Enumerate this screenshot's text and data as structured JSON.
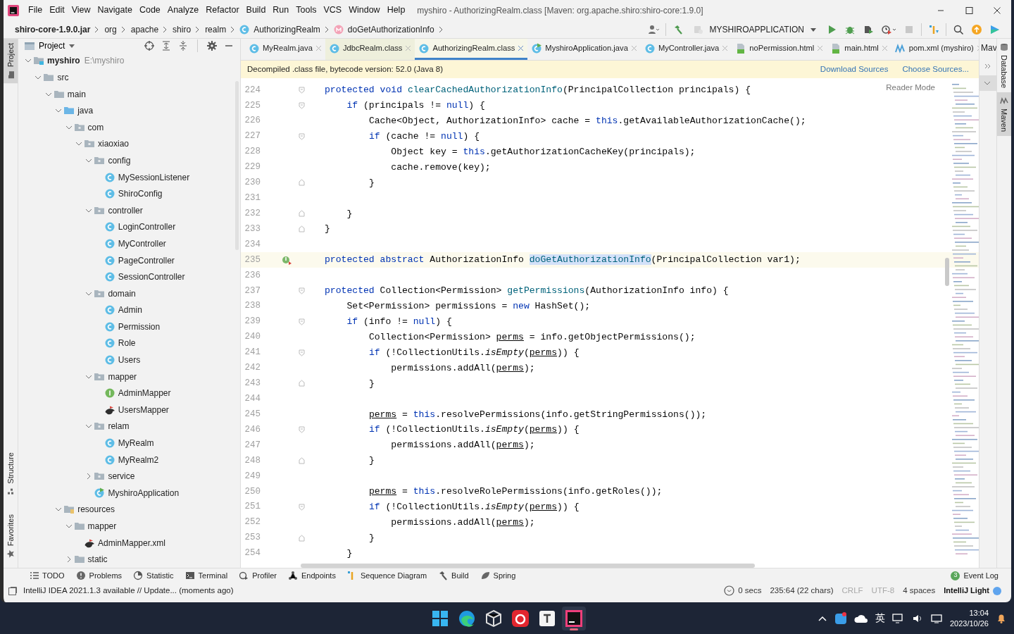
{
  "window": {
    "title": "myshiro - AuthorizingRealm.class [Maven: org.apache.shiro:shiro-core:1.9.0]"
  },
  "menu": [
    "File",
    "Edit",
    "View",
    "Navigate",
    "Code",
    "Analyze",
    "Refactor",
    "Build",
    "Run",
    "Tools",
    "VCS",
    "Window",
    "Help"
  ],
  "breadcrumb": [
    {
      "text": "shiro-core-1.9.0.jar",
      "kind": "jar"
    },
    {
      "text": "org",
      "kind": "package"
    },
    {
      "text": "apache",
      "kind": "package"
    },
    {
      "text": "shiro",
      "kind": "package"
    },
    {
      "text": "realm",
      "kind": "package"
    },
    {
      "text": "AuthorizingRealm",
      "kind": "class"
    },
    {
      "text": "doGetAuthorizationInfo",
      "kind": "method"
    }
  ],
  "run_config": "MYSHIROAPPLICATION",
  "left_stripe": [
    {
      "label": "Project",
      "kind": "project",
      "selected": true
    },
    {
      "label": "Structure",
      "kind": "structure",
      "selected": false
    },
    {
      "label": "Favorites",
      "kind": "favorites",
      "selected": false
    }
  ],
  "project": {
    "title": "Project",
    "tree": [
      {
        "label": "myshiro",
        "hint": "E:\\myshiro",
        "kind": "module",
        "expanded": true,
        "children": [
          {
            "label": "src",
            "kind": "folder",
            "expanded": true,
            "children": [
              {
                "label": "main",
                "kind": "folder",
                "expanded": true,
                "children": [
                  {
                    "label": "java",
                    "kind": "source",
                    "expanded": true,
                    "children": [
                      {
                        "label": "com",
                        "kind": "package",
                        "expanded": true,
                        "children": [
                          {
                            "label": "xiaoxiao",
                            "kind": "package",
                            "expanded": true,
                            "children": [
                              {
                                "label": "config",
                                "kind": "package",
                                "expanded": true,
                                "children": [
                                  {
                                    "label": "MySessionListener",
                                    "kind": "class"
                                  },
                                  {
                                    "label": "ShiroConfig",
                                    "kind": "class"
                                  }
                                ]
                              },
                              {
                                "label": "controller",
                                "kind": "package",
                                "expanded": true,
                                "children": [
                                  {
                                    "label": "LoginController",
                                    "kind": "class"
                                  },
                                  {
                                    "label": "MyController",
                                    "kind": "class"
                                  },
                                  {
                                    "label": "PageController",
                                    "kind": "class"
                                  },
                                  {
                                    "label": "SessionController",
                                    "kind": "class"
                                  }
                                ]
                              },
                              {
                                "label": "domain",
                                "kind": "package",
                                "expanded": true,
                                "children": [
                                  {
                                    "label": "Admin",
                                    "kind": "class"
                                  },
                                  {
                                    "label": "Permission",
                                    "kind": "class"
                                  },
                                  {
                                    "label": "Role",
                                    "kind": "class"
                                  },
                                  {
                                    "label": "Users",
                                    "kind": "class"
                                  }
                                ]
                              },
                              {
                                "label": "mapper",
                                "kind": "package",
                                "expanded": true,
                                "children": [
                                  {
                                    "label": "AdminMapper",
                                    "kind": "interface"
                                  },
                                  {
                                    "label": "UsersMapper",
                                    "kind": "mapper"
                                  }
                                ]
                              },
                              {
                                "label": "relam",
                                "kind": "package",
                                "expanded": true,
                                "children": [
                                  {
                                    "label": "MyRealm",
                                    "kind": "class"
                                  },
                                  {
                                    "label": "MyRealm2",
                                    "kind": "class"
                                  }
                                ]
                              },
                              {
                                "label": "service",
                                "kind": "package",
                                "expanded": false
                              },
                              {
                                "label": "MyshiroApplication",
                                "kind": "app"
                              }
                            ]
                          }
                        ]
                      }
                    ]
                  },
                  {
                    "label": "resources",
                    "kind": "resources",
                    "expanded": true,
                    "children": [
                      {
                        "label": "mapper",
                        "kind": "folder",
                        "expanded": true,
                        "children": [
                          {
                            "label": "AdminMapper.xml",
                            "kind": "mapper"
                          }
                        ]
                      },
                      {
                        "label": "static",
                        "kind": "folder",
                        "expanded": false
                      }
                    ]
                  }
                ]
              }
            ]
          }
        ]
      }
    ]
  },
  "tabs": [
    {
      "label": "MyRealm.java",
      "kind": "class",
      "selected": false
    },
    {
      "label": "JdbcRealm.class",
      "kind": "class",
      "selected": false,
      "color": "#eeefdc"
    },
    {
      "label": "AuthorizingRealm.class",
      "kind": "class",
      "selected": true,
      "color": "#f6f6e9"
    },
    {
      "label": "MyshiroApplication.java",
      "kind": "app",
      "selected": false
    },
    {
      "label": "MyController.java",
      "kind": "class",
      "selected": false
    },
    {
      "label": "noPermission.html",
      "kind": "html",
      "selected": false
    },
    {
      "label": "main.html",
      "kind": "html",
      "selected": false
    },
    {
      "label": "pom.xml (myshiro)",
      "kind": "maven",
      "selected": false
    }
  ],
  "notice": {
    "text": "Decompiled .class file, bytecode version: 52.0 (Java 8)",
    "links": [
      "Download Sources",
      "Choose Sources..."
    ]
  },
  "reader_mode": "Reader Mode",
  "code_lines": [
    {
      "number": "224",
      "fold_open": true,
      "fold_close": false,
      "current": false,
      "tokens": [
        {
          "kind": "kw",
          "text": "protected void "
        },
        {
          "kind": "decl",
          "text": "clearCachedAuthorizationInfo"
        },
        {
          "kind": "plain",
          "text": "(PrincipalCollection principals) {"
        }
      ]
    },
    {
      "number": "225",
      "fold_open": true,
      "fold_close": false,
      "current": false,
      "tokens": [
        {
          "kind": "kw",
          "text": "    if"
        },
        {
          "kind": "plain",
          "text": " (principals != "
        },
        {
          "kind": "kw",
          "text": "null"
        },
        {
          "kind": "plain",
          "text": ") {"
        }
      ]
    },
    {
      "number": "226",
      "fold_open": false,
      "fold_close": false,
      "current": false,
      "tokens": [
        {
          "kind": "plain",
          "text": "        Cache<Object, AuthorizationInfo> cache = "
        },
        {
          "kind": "kw",
          "text": "this"
        },
        {
          "kind": "plain",
          "text": ".getAvailableAuthorizationCache();"
        }
      ]
    },
    {
      "number": "227",
      "fold_open": true,
      "fold_close": false,
      "current": false,
      "tokens": [
        {
          "kind": "kw",
          "text": "        if"
        },
        {
          "kind": "plain",
          "text": " (cache != "
        },
        {
          "kind": "kw",
          "text": "null"
        },
        {
          "kind": "plain",
          "text": ") {"
        }
      ]
    },
    {
      "number": "228",
      "fold_open": false,
      "fold_close": false,
      "current": false,
      "tokens": [
        {
          "kind": "plain",
          "text": "            Object key = "
        },
        {
          "kind": "kw",
          "text": "this"
        },
        {
          "kind": "plain",
          "text": ".getAuthorizationCacheKey(principals);"
        }
      ]
    },
    {
      "number": "229",
      "fold_open": false,
      "fold_close": false,
      "current": false,
      "tokens": [
        {
          "kind": "plain",
          "text": "            cache.remove(key);"
        }
      ]
    },
    {
      "number": "230",
      "fold_open": false,
      "fold_close": true,
      "current": false,
      "tokens": [
        {
          "kind": "plain",
          "text": "        }"
        }
      ]
    },
    {
      "number": "231",
      "fold_open": false,
      "fold_close": false,
      "current": false
    },
    {
      "number": "232",
      "fold_open": false,
      "fold_close": true,
      "current": false,
      "tokens": [
        {
          "kind": "plain",
          "text": "    }"
        }
      ]
    },
    {
      "number": "233",
      "fold_open": false,
      "fold_close": true,
      "current": false,
      "tokens": [
        {
          "kind": "plain",
          "text": "}"
        }
      ]
    },
    {
      "number": "234",
      "fold_open": false,
      "fold_close": false,
      "current": false
    },
    {
      "number": "235",
      "fold_open": false,
      "fold_close": false,
      "current": true,
      "implemented": true,
      "tokens": [
        {
          "kind": "kw",
          "text": "protected abstract "
        },
        {
          "kind": "plain",
          "text": "AuthorizationInfo "
        },
        {
          "kind": "highlight",
          "text": "doGetAuthorizationInfo"
        },
        {
          "kind": "plain",
          "text": "(PrincipalCollection var1);"
        }
      ]
    },
    {
      "number": "236",
      "fold_open": false,
      "fold_close": false,
      "current": false
    },
    {
      "number": "237",
      "fold_open": true,
      "fold_close": false,
      "current": false,
      "tokens": [
        {
          "kind": "kw",
          "text": "protected "
        },
        {
          "kind": "plain",
          "text": "Collection<Permission> "
        },
        {
          "kind": "decl",
          "text": "getPermissions"
        },
        {
          "kind": "plain",
          "text": "(AuthorizationInfo info) {"
        }
      ]
    },
    {
      "number": "238",
      "fold_open": false,
      "fold_close": false,
      "current": false,
      "tokens": [
        {
          "kind": "plain",
          "text": "    Set<Permission> permissions = "
        },
        {
          "kind": "kw",
          "text": "new"
        },
        {
          "kind": "plain",
          "text": " HashSet();"
        }
      ]
    },
    {
      "number": "239",
      "fold_open": true,
      "fold_close": false,
      "current": false,
      "tokens": [
        {
          "kind": "kw",
          "text": "    if"
        },
        {
          "kind": "plain",
          "text": " (info != "
        },
        {
          "kind": "kw",
          "text": "null"
        },
        {
          "kind": "plain",
          "text": ") {"
        }
      ]
    },
    {
      "number": "240",
      "fold_open": false,
      "fold_close": false,
      "current": false,
      "tokens": [
        {
          "kind": "plain",
          "text": "        Collection<Permission> "
        },
        {
          "kind": "reassigned",
          "text": "perms"
        },
        {
          "kind": "plain",
          "text": " = info.getObjectPermissions();"
        }
      ]
    },
    {
      "number": "241",
      "fold_open": true,
      "fold_close": false,
      "current": false,
      "tokens": [
        {
          "kind": "kw",
          "text": "        if"
        },
        {
          "kind": "plain",
          "text": " (!CollectionUtils."
        },
        {
          "kind": "static",
          "text": "isEmpty"
        },
        {
          "kind": "plain",
          "text": "("
        },
        {
          "kind": "reassigned",
          "text": "perms"
        },
        {
          "kind": "plain",
          "text": ")) {"
        }
      ]
    },
    {
      "number": "242",
      "fold_open": false,
      "fold_close": false,
      "current": false,
      "tokens": [
        {
          "kind": "plain",
          "text": "            permissions.addAll("
        },
        {
          "kind": "reassigned",
          "text": "perms"
        },
        {
          "kind": "plain",
          "text": ");"
        }
      ]
    },
    {
      "number": "243",
      "fold_open": false,
      "fold_close": true,
      "current": false,
      "tokens": [
        {
          "kind": "plain",
          "text": "        }"
        }
      ]
    },
    {
      "number": "244",
      "fold_open": false,
      "fold_close": false,
      "current": false
    },
    {
      "number": "245",
      "fold_open": false,
      "fold_close": false,
      "current": false,
      "tokens": [
        {
          "kind": "reassigned",
          "text": "        perms"
        },
        {
          "kind": "plain",
          "text": " = "
        },
        {
          "kind": "kw",
          "text": "this"
        },
        {
          "kind": "plain",
          "text": ".resolvePermissions(info.getStringPermissions());"
        }
      ]
    },
    {
      "number": "246",
      "fold_open": true,
      "fold_close": false,
      "current": false,
      "tokens": [
        {
          "kind": "kw",
          "text": "        if"
        },
        {
          "kind": "plain",
          "text": " (!CollectionUtils."
        },
        {
          "kind": "static",
          "text": "isEmpty"
        },
        {
          "kind": "plain",
          "text": "("
        },
        {
          "kind": "reassigned",
          "text": "perms"
        },
        {
          "kind": "plain",
          "text": ")) {"
        }
      ]
    },
    {
      "number": "247",
      "fold_open": false,
      "fold_close": false,
      "current": false,
      "tokens": [
        {
          "kind": "plain",
          "text": "            permissions.addAll("
        },
        {
          "kind": "reassigned",
          "text": "perms"
        },
        {
          "kind": "plain",
          "text": ");"
        }
      ]
    },
    {
      "number": "248",
      "fold_open": false,
      "fold_close": true,
      "current": false,
      "tokens": [
        {
          "kind": "plain",
          "text": "        }"
        }
      ]
    },
    {
      "number": "249",
      "fold_open": false,
      "fold_close": false,
      "current": false
    },
    {
      "number": "250",
      "fold_open": false,
      "fold_close": false,
      "current": false,
      "tokens": [
        {
          "kind": "reassigned",
          "text": "        perms"
        },
        {
          "kind": "plain",
          "text": " = "
        },
        {
          "kind": "kw",
          "text": "this"
        },
        {
          "kind": "plain",
          "text": ".resolveRolePermissions(info.getRoles());"
        }
      ]
    },
    {
      "number": "251",
      "fold_open": true,
      "fold_close": false,
      "current": false,
      "tokens": [
        {
          "kind": "kw",
          "text": "        if"
        },
        {
          "kind": "plain",
          "text": " (!CollectionUtils."
        },
        {
          "kind": "static",
          "text": "isEmpty"
        },
        {
          "kind": "plain",
          "text": "("
        },
        {
          "kind": "reassigned",
          "text": "perms"
        },
        {
          "kind": "plain",
          "text": ")) {"
        }
      ]
    },
    {
      "number": "252",
      "fold_open": false,
      "fold_close": false,
      "current": false,
      "tokens": [
        {
          "kind": "plain",
          "text": "            permissions.addAll("
        },
        {
          "kind": "reassigned",
          "text": "perms"
        },
        {
          "kind": "plain",
          "text": ");"
        }
      ]
    },
    {
      "number": "253",
      "fold_open": false,
      "fold_close": true,
      "current": false,
      "tokens": [
        {
          "kind": "plain",
          "text": "        }"
        }
      ]
    },
    {
      "number": "254",
      "fold_open": false,
      "fold_close": false,
      "current": false,
      "tokens": [
        {
          "kind": "plain",
          "text": "    }"
        }
      ]
    }
  ],
  "maven_panel": {
    "title": "Mav"
  },
  "right_stripe": [
    {
      "label": "Database",
      "kind": "database",
      "selected": false
    },
    {
      "label": "Maven",
      "kind": "maven",
      "selected": true
    }
  ],
  "tool_windows": [
    {
      "label": "TODO",
      "kind": "todo"
    },
    {
      "label": "Problems",
      "kind": "problems"
    },
    {
      "label": "Statistic",
      "kind": "statistic"
    },
    {
      "label": "Terminal",
      "kind": "terminal"
    },
    {
      "label": "Profiler",
      "kind": "profiler"
    },
    {
      "label": "Endpoints",
      "kind": "endpoints"
    },
    {
      "label": "Sequence Diagram",
      "kind": "sequence"
    },
    {
      "label": "Build",
      "kind": "build"
    },
    {
      "label": "Spring",
      "kind": "spring"
    }
  ],
  "event_log": {
    "count": "3",
    "label": "Event Log"
  },
  "status": {
    "message": "IntelliJ IDEA 2021.1.3 available // Update... (moments ago)",
    "items": [
      {
        "text": "0 secs",
        "kind": "timer",
        "disabled": false
      },
      {
        "text": "235:64 (22 chars)",
        "kind": "plain",
        "disabled": false
      },
      {
        "text": "CRLF",
        "kind": "plain",
        "disabled": true
      },
      {
        "text": "UTF-8",
        "kind": "plain",
        "disabled": true
      },
      {
        "text": "4 spaces",
        "kind": "plain",
        "disabled": false
      },
      {
        "text": "IntelliJ Light",
        "kind": "theme",
        "disabled": false
      }
    ]
  },
  "taskbar": {
    "apps": [
      {
        "kind": "start",
        "selected": false
      },
      {
        "kind": "browser",
        "selected": false
      },
      {
        "kind": "cube",
        "selected": false
      },
      {
        "kind": "music",
        "selected": false
      },
      {
        "kind": "editor",
        "selected": false
      },
      {
        "kind": "ide",
        "selected": true
      }
    ],
    "ime": "英",
    "time": "13:04",
    "date": "2023/10/26"
  }
}
